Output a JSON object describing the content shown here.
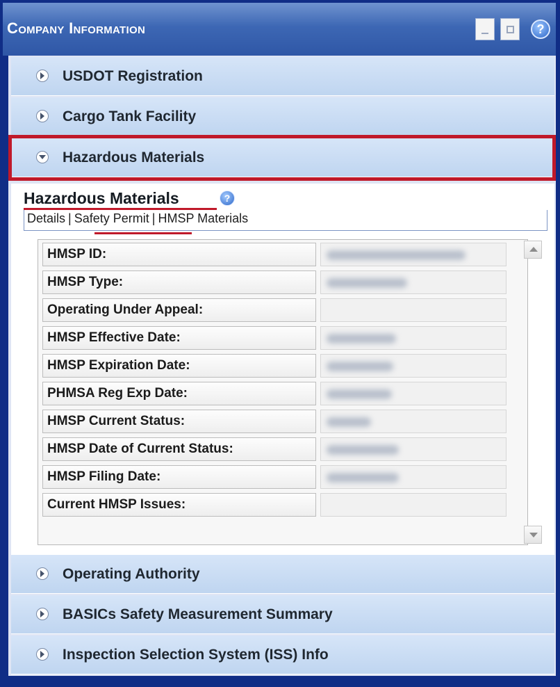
{
  "window": {
    "title": "Company Information",
    "minimize_icon": "minimize-icon",
    "maximize_icon": "maximize-icon",
    "help_icon": "help-icon",
    "help_glyph": "?"
  },
  "sections_top": [
    {
      "label": "USDOT Registration"
    },
    {
      "label": "Cargo Tank Facility"
    },
    {
      "label": "Hazardous Materials",
      "expanded": true
    }
  ],
  "panel": {
    "title": "Hazardous Materials",
    "help_glyph": "?",
    "tabs": [
      "Details",
      "Safety Permit",
      "HMSP Materials"
    ],
    "separator": "|",
    "rows": [
      {
        "label": "HMSP ID:"
      },
      {
        "label": "HMSP Type:"
      },
      {
        "label": "Operating Under Appeal:"
      },
      {
        "label": "HMSP Effective Date:"
      },
      {
        "label": "HMSP Expiration Date:"
      },
      {
        "label": "PHMSA Reg Exp Date:"
      },
      {
        "label": "HMSP Current Status:"
      },
      {
        "label": "HMSP Date of Current Status:"
      },
      {
        "label": "HMSP Filing Date:"
      },
      {
        "label": "Current HMSP Issues:"
      }
    ]
  },
  "sections_bottom": [
    {
      "label": "Operating Authority"
    },
    {
      "label": "BASICs Safety Measurement Summary"
    },
    {
      "label": "Inspection Selection System (ISS) Info"
    }
  ],
  "colors": {
    "frame": "#102d86",
    "title_bar": "#3d67b4",
    "highlight": "#c0192a",
    "section_bg": "#c9dcf3"
  }
}
